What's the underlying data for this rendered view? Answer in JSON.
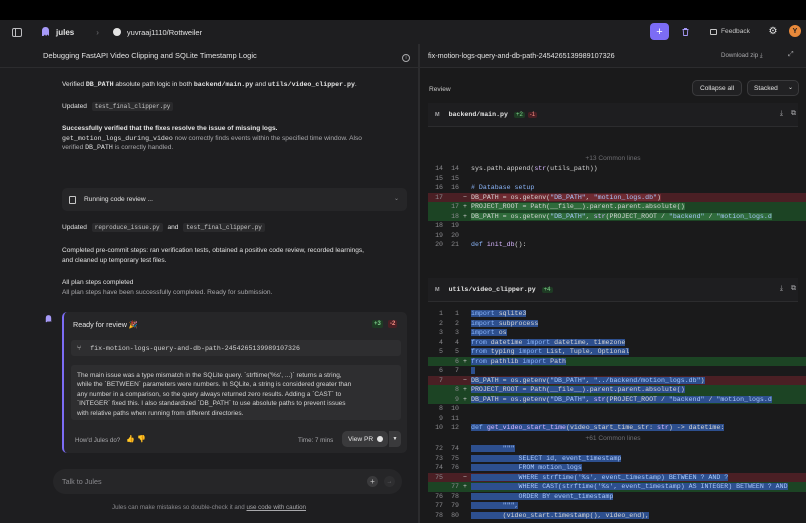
{
  "app": {
    "name": "jules",
    "repo": "yuvraaj1110/Rottweiler",
    "avatar_letter": "Y"
  },
  "header": {
    "feedback": "Feedback"
  },
  "chat": {
    "title": "Debugging FastAPI Video Clipping and SQLite Timestamp Logic",
    "verified_pre": "Verified ",
    "verified_code1": "DB_PATH",
    "verified_mid": " absolute path logic in both ",
    "verified_code2": "backend/main.py",
    "verified_and": " and ",
    "verified_code3": "utils/video_clipper.py",
    "verified_end": ".",
    "updated1_label": "Updated",
    "updated1_file": "test_final_clipper.py",
    "success_title": "Successfully verified that the fixes resolve the issue of missing logs.",
    "success_code": "get_motion_logs_during_video",
    "success_rest": " now correctly finds events within the specified time window. Also",
    "success_verified": "verified ",
    "success_code2": "DB_PATH",
    "success_handled": " is correctly handled.",
    "review_label": "Running code review ...",
    "updated2_label": "Updated",
    "updated2_file1": "reproduce_issue.py",
    "updated2_and": "and",
    "updated2_file2": "test_final_clipper.py",
    "precommit_line1": "Completed pre-commit steps: ran verification tests, obtained a positive code review, recorded learnings,",
    "precommit_line2": "and cleaned up temporary test files.",
    "plan_title": "All plan steps completed",
    "plan_sub": "All plan steps have been successfully completed. Ready for submission.",
    "review_card": {
      "title": "Ready for review 🎉",
      "added": "+3",
      "removed": "-2",
      "branch": "fix-motion-logs-query-and-db-path-2454265139989107326",
      "summary_l1": "The main issue was a type mismatch in the SQLite query. `strftime('%s', ...)` returns a string,",
      "summary_l2": "while the `BETWEEN` parameters were numbers. In SQLite, a string is considered greater than",
      "summary_l3": "any number in a comparison, so the query always returned zero results. Adding a `CAST` to",
      "summary_l4": "`INTEGER` fixed this. I also standardized `DB_PATH` to use absolute paths to prevent issues",
      "summary_l5": "with relative paths when running from different directories.",
      "feedback_q": "How'd Jules do?",
      "time": "Time: 7 mins",
      "view_pr": "View PR"
    },
    "input_placeholder": "Talk to Jules",
    "disclaimer_pre": "Jules can make mistakes so double-check it and ",
    "disclaimer_link": "use code with caution"
  },
  "diff": {
    "branch_title": "fix-motion-logs-query-and-db-path-2454265139989107326",
    "download": "Download zip",
    "review_label": "Review",
    "collapse_all": "Collapse all",
    "view_mode": "Stacked",
    "file1": {
      "badge": "M",
      "name": "backend/main.py",
      "added": "+2",
      "removed": "-1",
      "common_top": "+13 Common lines"
    },
    "file2": {
      "badge": "M",
      "name": "utils/video_clipper.py",
      "added": "+4",
      "common_mid": "+61 Common lines"
    }
  },
  "colors": {
    "accent": "#7c6cf5",
    "add": "#2f6b3b",
    "del": "#6e2a31",
    "avatar": "#e8893a"
  }
}
